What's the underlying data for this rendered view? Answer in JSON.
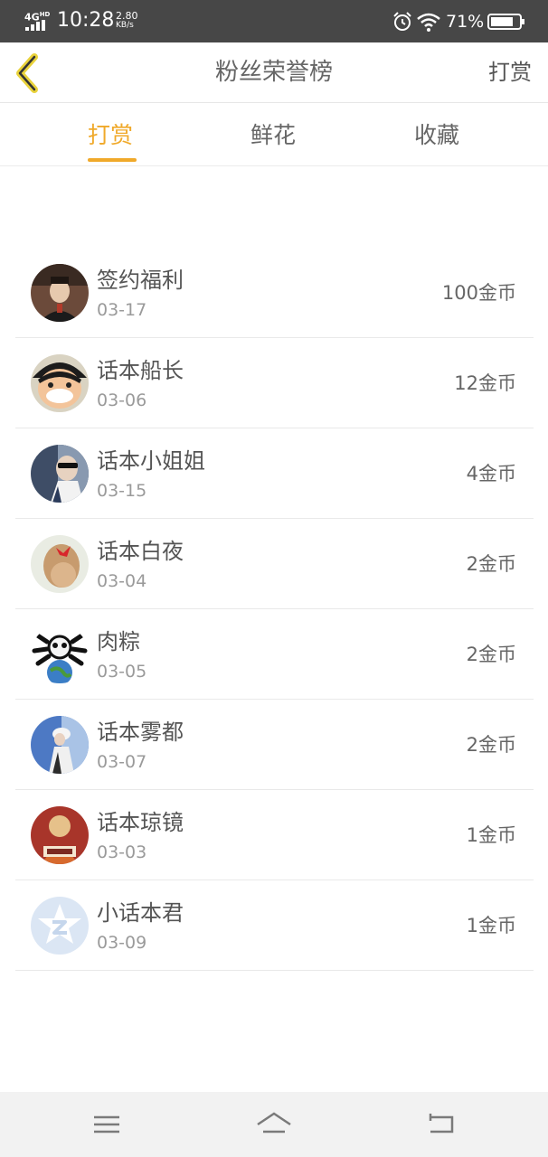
{
  "status_bar": {
    "network": "4G",
    "network_sup": "HD",
    "time": "10:28",
    "speed_value": "2.80",
    "speed_unit": "KB/s",
    "battery": "71%"
  },
  "header": {
    "title": "粉丝荣誉榜",
    "action": "打赏"
  },
  "tabs": [
    {
      "label": "打赏",
      "active": true
    },
    {
      "label": "鲜花",
      "active": false
    },
    {
      "label": "收藏",
      "active": false
    }
  ],
  "fans": [
    {
      "name": "签约福利",
      "date": "03-17",
      "amount": "100金币",
      "avatar": "portrait-avatar"
    },
    {
      "name": "话本船长",
      "date": "03-06",
      "amount": "12金币",
      "avatar": "cartoon-pirate-avatar"
    },
    {
      "name": "话本小姐姐",
      "date": "03-15",
      "amount": "4金币",
      "avatar": "sunglasses-avatar"
    },
    {
      "name": "话本白夜",
      "date": "03-04",
      "amount": "2金币",
      "avatar": "hair-bow-avatar"
    },
    {
      "name": "肉粽",
      "date": "03-05",
      "amount": "2金币",
      "avatar": "panda-globe-avatar"
    },
    {
      "name": "话本雾都",
      "date": "03-07",
      "amount": "2金币",
      "avatar": "blue-figure-avatar"
    },
    {
      "name": "话本琼镜",
      "date": "03-03",
      "amount": "1金币",
      "avatar": "book-cover-avatar"
    },
    {
      "name": "小话本君",
      "date": "03-09",
      "amount": "1金币",
      "avatar": "default-star-avatar"
    }
  ],
  "colors": {
    "accent": "#f0a92a",
    "status_bar": "#474747",
    "nav_bar": "#f2f2f2"
  }
}
